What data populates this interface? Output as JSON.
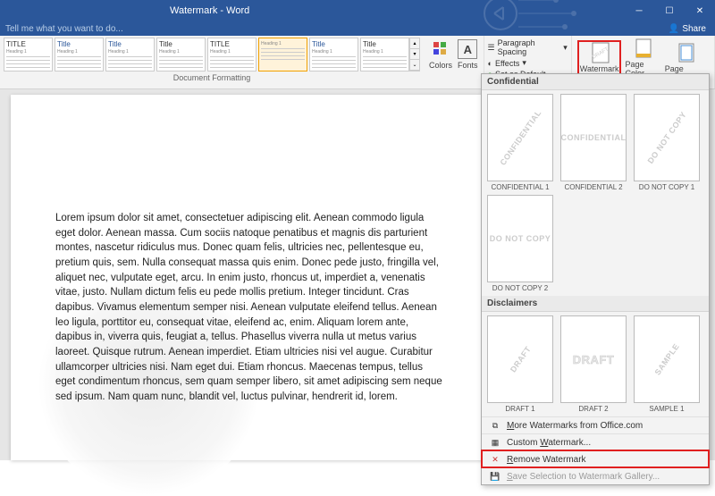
{
  "window": {
    "title": "Watermark - Word"
  },
  "tellme": {
    "placeholder": "Tell me what you want to do...",
    "share": "Share"
  },
  "ribbon": {
    "styles": [
      {
        "title": "TITLE",
        "blue": false
      },
      {
        "title": "Title",
        "blue": true
      },
      {
        "title": "Title",
        "blue": true
      },
      {
        "title": "Title",
        "blue": false
      },
      {
        "title": "TITLE",
        "blue": false
      },
      {
        "title": "",
        "blue": true,
        "sel": true
      },
      {
        "title": "Title",
        "blue": true
      },
      {
        "title": "Title",
        "blue": false
      }
    ],
    "heading_label": "Heading 1",
    "group_docfmt": "Document Formatting",
    "colors": "Colors",
    "fonts": "Fonts",
    "paragraph_spacing": "Paragraph Spacing",
    "effects": "Effects",
    "set_default": "Set as Default",
    "watermark": "Watermark",
    "page_color": "Page Color",
    "page_borders": "Page Borders"
  },
  "document": {
    "body": "Lorem ipsum dolor sit amet, consectetuer adipiscing elit. Aenean commodo ligula eget dolor. Aenean massa. Cum sociis natoque penatibus et magnis dis parturient montes, nascetur ridiculus mus. Donec quam felis, ultricies nec, pellentesque eu, pretium quis, sem. Nulla consequat massa quis enim. Donec pede justo, fringilla vel, aliquet nec, vulputate eget, arcu. In enim justo, rhoncus ut, imperdiet a, venenatis vitae, justo. Nullam dictum felis eu pede mollis pretium. Integer tincidunt. Cras dapibus. Vivamus elementum semper nisi. Aenean vulputate eleifend tellus. Aenean leo ligula, porttitor eu, consequat vitae, eleifend ac, enim. Aliquam lorem ante, dapibus in, viverra quis, feugiat a, tellus. Phasellus viverra nulla ut metus varius laoreet. Quisque rutrum. Aenean imperdiet. Etiam ultricies nisi vel augue. Curabitur ullamcorper ultricies nisi. Nam eget dui. Etiam rhoncus. Maecenas tempus, tellus eget condimentum rhoncus, sem quam semper libero, sit amet adipiscing sem neque sed ipsum. Nam quam nunc, blandit vel, luctus pulvinar, hendrerit id, lorem."
  },
  "dropdown": {
    "sections": {
      "confidential": "Confidential",
      "disclaimers": "Disclaimers"
    },
    "items_confidential": [
      {
        "text": "CONFIDENTIAL",
        "caption": "CONFIDENTIAL 1",
        "style": "diag"
      },
      {
        "text": "CONFIDENTIAL",
        "caption": "CONFIDENTIAL 2",
        "style": "horiz"
      },
      {
        "text": "DO NOT COPY",
        "caption": "DO NOT COPY 1",
        "style": "diag"
      },
      {
        "text": "DO NOT COPY",
        "caption": "DO NOT COPY 2",
        "style": "horiz"
      }
    ],
    "items_disclaimers": [
      {
        "text": "DRAFT",
        "caption": "DRAFT 1",
        "style": "diag"
      },
      {
        "text": "DRAFT",
        "caption": "DRAFT 2",
        "style": "out"
      },
      {
        "text": "SAMPLE",
        "caption": "SAMPLE 1",
        "style": "diag"
      }
    ],
    "more": "More Watermarks from Office.com",
    "custom": "Custom Watermark...",
    "remove": "Remove Watermark",
    "save_gallery": "Save Selection to Watermark Gallery..."
  }
}
